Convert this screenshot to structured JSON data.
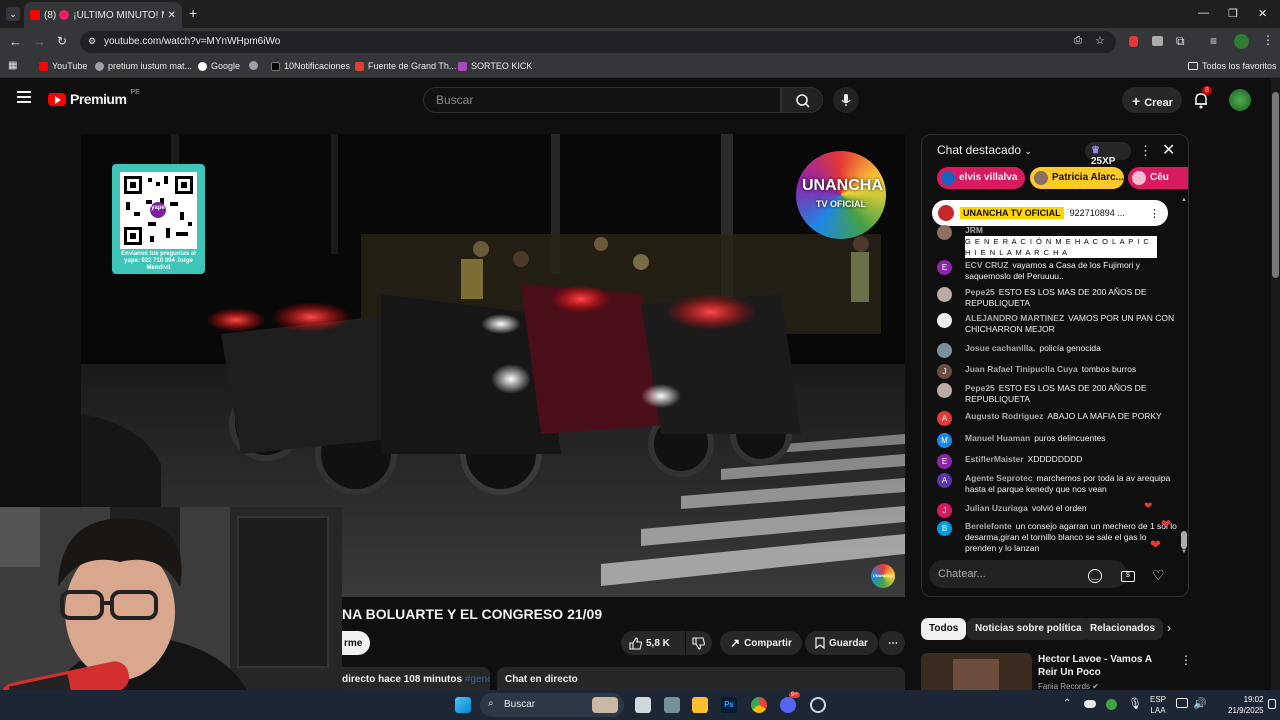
{
  "browser": {
    "tab_count_prefix": "(8)",
    "tab_title": "¡ÚLTIMO MINUTO! MARC",
    "url": "youtube.com/watch?v=MYnWHpm6iWo",
    "bookmarks": [
      "YouTube",
      "pretium iustum mat...",
      "Google",
      "10Notificaciones",
      "Fuente de Grand Th...",
      "SORTEO KICK"
    ],
    "all_bookmarks": "Todos los favoritos"
  },
  "youtube": {
    "logo_text": "Premium",
    "region": "PE",
    "search_placeholder": "Buscar",
    "create_label": "Crear",
    "notif_count": "8"
  },
  "video": {
    "title": "NA BOLUARTE Y EL CONGRESO 21/09",
    "qr_caption": "Envíanos tus preguntas al yape: 922 710 894 Jorge Mendivil",
    "qr_label": "yape",
    "logo_line1": "UNANCHA",
    "logo_line2": "TV OFICIAL",
    "watermark": "UNANCHA",
    "subscribe_fragment": "rme",
    "likes": "5,8 K",
    "share_label": "Compartir",
    "save_label": "Guardar",
    "meta": "directo hace 108 minutos",
    "meta_tag": "#gene",
    "live_chat_label": "Chat en directo"
  },
  "chat": {
    "header": "Chat destacado",
    "xp": "25XP",
    "donors": [
      "elvis villalva",
      "Patricia Alarc...",
      "Cêu"
    ],
    "pinned_channel": "UNANCHA TV OFICIAL",
    "pinned_text": "922710894 ...",
    "messages": [
      {
        "author": "JRM",
        "text": "G E N E R A C I Ó N M E H A C O L A P I C H I E N L A M A R C H A",
        "initial": "",
        "color": "#8d6e63"
      },
      {
        "author": "ECV CRUZ",
        "text": "vayamos a Casa de los Fujimori y saquemoslo del Peruuuu..",
        "initial": "E",
        "color": "#8e24aa"
      },
      {
        "author": "Pepe25",
        "text": "ESTO ES LOS MAS DE 200 AÑOS DE REPUBLIQUETA",
        "initial": "",
        "color": "#bcaaa4"
      },
      {
        "author": "ALEJANDRO MARTINEZ",
        "text": "VAMOS POR UN PAN CON CHICHARRON MEJOR",
        "initial": "",
        "color": "#eeeeee"
      },
      {
        "author": "Josue cachanilla.",
        "text": "policía genocida",
        "initial": "",
        "color": "#78909c"
      },
      {
        "author": "Juan Rafael Tinipuclla Cuya",
        "text": "tombos burros",
        "initial": "J",
        "color": "#6d4c41"
      },
      {
        "author": "Pepe25",
        "text": "ESTO ES LOS MAS DE 200 AÑOS DE REPUBLIQUETA",
        "initial": "",
        "color": "#bcaaa4"
      },
      {
        "author": "Augusto Rodriguez",
        "text": "ABAJO LA MAFIA DE PORKY",
        "initial": "A",
        "color": "#e53935"
      },
      {
        "author": "Manuel Huaman",
        "text": "puros delincuentes",
        "initial": "M",
        "color": "#1e88e5"
      },
      {
        "author": "EstiflerMaister",
        "text": "XDDDDDDDD",
        "initial": "E",
        "color": "#8e24aa"
      },
      {
        "author": "Agente Seprotec",
        "text": "marchemos por toda la av arequipa hasta el parque kenedy que nos vean",
        "initial": "A",
        "color": "#5e35b1"
      },
      {
        "author": "Julian Uzuriaga",
        "text": "volvió el orden",
        "initial": "J",
        "color": "#d81b60"
      },
      {
        "author": "Berelefonte",
        "text": "un consejo agarran un mechero de 1 sol lo desarma,giran el tornillo blanco se sale el gas lo prenden y lo lanzan",
        "initial": "B",
        "color": "#039be5"
      }
    ],
    "input_placeholder": "Chatear..."
  },
  "related": {
    "chips": [
      "Todos",
      "Noticias sobre política",
      "Relacionados"
    ],
    "item_title": "Hector Lavoe - Vamos A Reir Un Poco",
    "item_channel": "Fania Records"
  },
  "taskbar": {
    "search": "Buscar",
    "lang": "ESP",
    "lang2": "LAA",
    "time": "19:02",
    "date": "21/9/2025",
    "discord_badge": "9+"
  }
}
